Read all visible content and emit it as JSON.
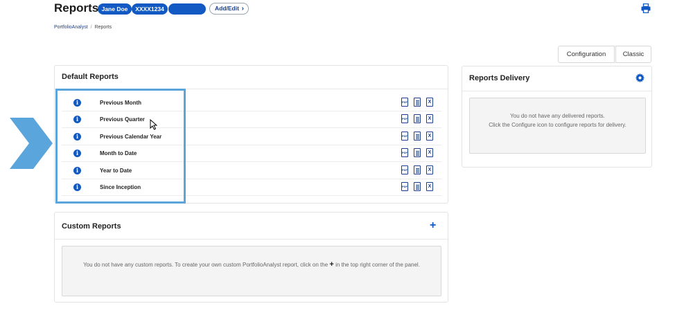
{
  "header": {
    "title": "Reports",
    "account_pills": [
      "Jane Doe",
      "XXXX1234",
      ""
    ],
    "add_edit_label": "Add/Edit",
    "add_edit_chevron": "›"
  },
  "breadcrumb": {
    "parent": "PortfolioAnalyst",
    "separator": "/",
    "current": "Reports"
  },
  "view_toggle": {
    "configuration": "Configuration",
    "classic": "Classic"
  },
  "default_reports": {
    "title": "Default Reports",
    "info_glyph": "i",
    "pdf_label": "PDF",
    "xls_label": "X",
    "rows": [
      {
        "name": "Previous Month"
      },
      {
        "name": "Previous Quarter"
      },
      {
        "name": "Previous Calendar Year"
      },
      {
        "name": "Month to Date"
      },
      {
        "name": "Year to Date"
      },
      {
        "name": "Since Inception"
      }
    ]
  },
  "custom_reports": {
    "title": "Custom Reports",
    "add_glyph": "+",
    "empty_text_before": "You do not have any custom reports. To create your own custom PortfolioAnalyst report, click on the",
    "empty_plus": "+",
    "empty_text_after": "in the top right corner of the panel."
  },
  "reports_delivery": {
    "title": "Reports Delivery",
    "empty_line1": "You do not have any delivered reports.",
    "empty_line2": "Click the Configure icon to configure reports for delivery."
  },
  "colors": {
    "brand_blue": "#1259c3",
    "highlight": "#5aa5dc",
    "link": "#1b3f8a"
  },
  "icons": [
    "print-icon",
    "info-icon",
    "pdf-icon",
    "document-icon",
    "excel-icon",
    "gear-icon",
    "plus-icon",
    "chevron-arrow-icon",
    "cursor-icon"
  ]
}
